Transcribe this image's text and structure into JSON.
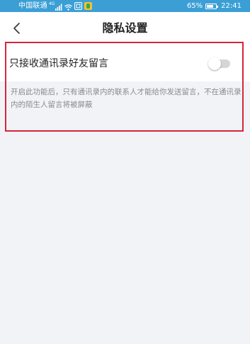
{
  "status_bar": {
    "carrier": "中国联通",
    "network_type": "4G",
    "battery_percent": "65%",
    "time": "22:41",
    "icons": [
      "signal-icon",
      "wifi-icon",
      "notification-app-icon",
      "app-icon",
      "battery-icon"
    ]
  },
  "header": {
    "title": "隐私设置",
    "back_icon": "chevron-left-icon"
  },
  "setting": {
    "label": "只接收通讯录好友留言",
    "enabled": false,
    "description": "开启此功能后，只有通讯录内的联系人才能给你发送留言，不在通讯录内的陌生人留言将被屏蔽"
  },
  "colors": {
    "status_bar": "#3b9fd6",
    "background": "#f2f3f7",
    "highlight": "#d6263a",
    "toggle_off": "#d6d6d6"
  }
}
